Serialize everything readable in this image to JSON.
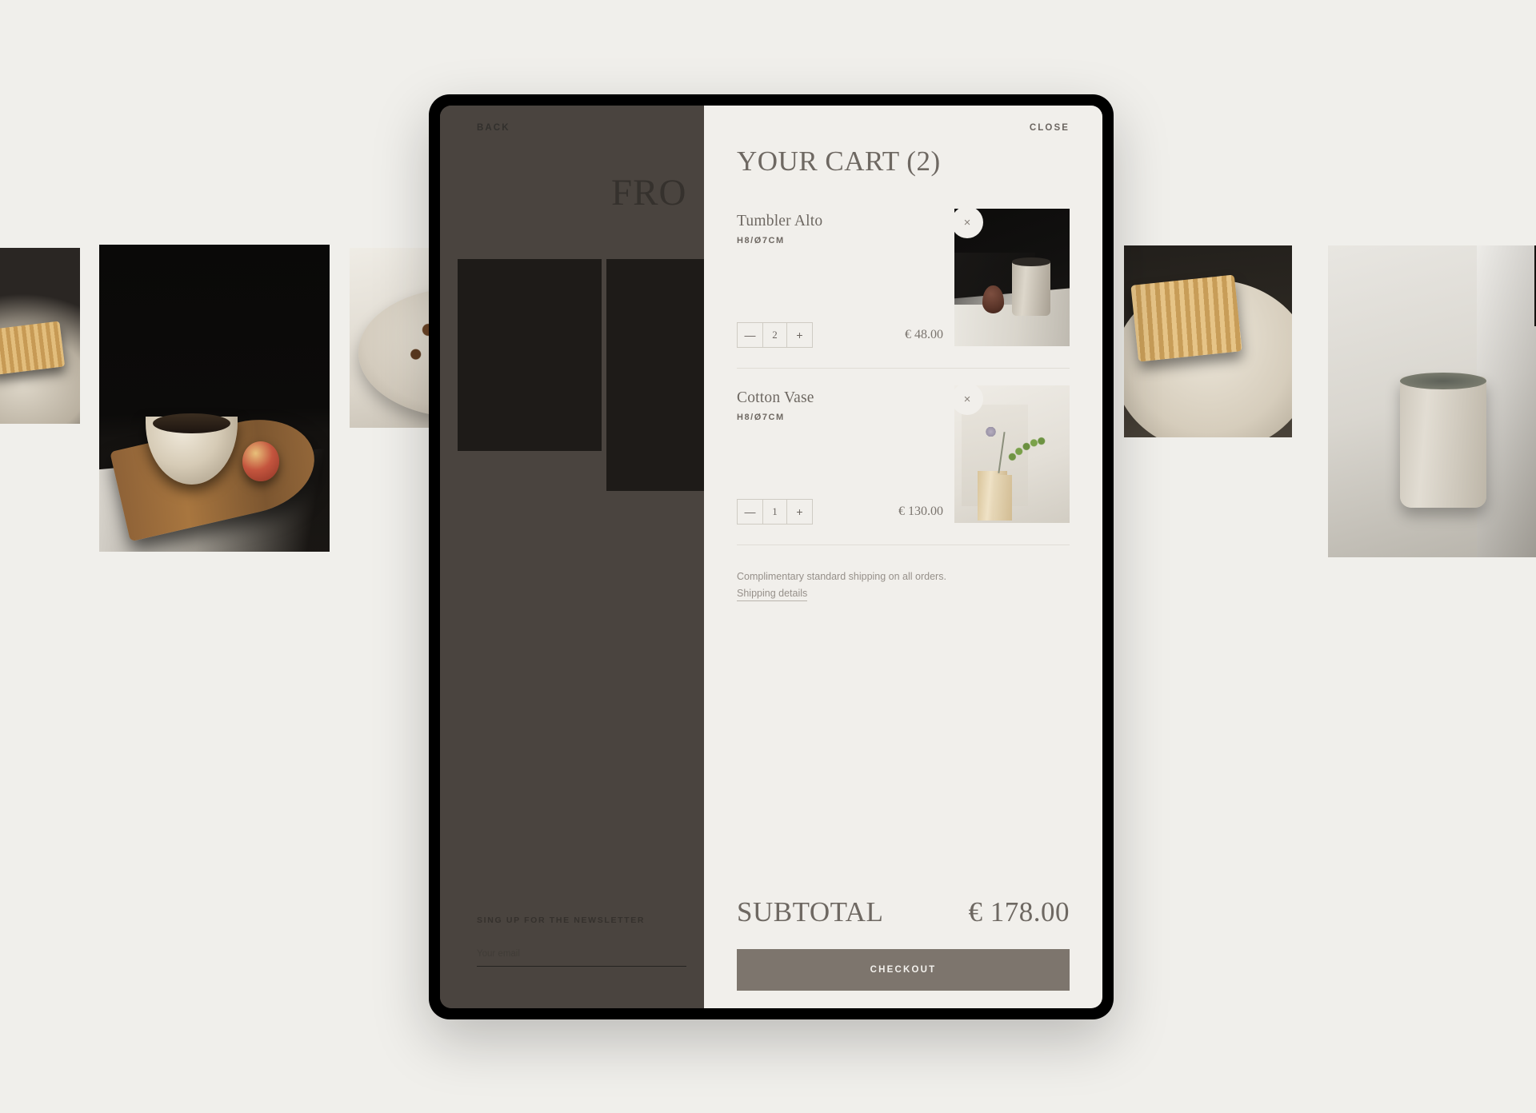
{
  "page": {
    "background_color": "#f0efeb"
  },
  "site": {
    "back_label": "BACK",
    "hero_heading": "FRO",
    "newsletter": {
      "label": "SING UP FOR THE NEWSLETTER",
      "email_placeholder": "Your email",
      "email_value": ""
    }
  },
  "cart": {
    "close_label": "CLOSE",
    "title": "YOUR CART (2)",
    "items": [
      {
        "name": "Tumbler Alto",
        "size": "H8/Ø7CM",
        "quantity": "2",
        "price": "€ 48.00",
        "decrease_label": "—",
        "increase_label": "+",
        "remove_label": "×"
      },
      {
        "name": "Cotton Vase",
        "size": "H8/Ø7CM",
        "quantity": "1",
        "price": "€ 130.00",
        "decrease_label": "—",
        "increase_label": "+",
        "remove_label": "×"
      }
    ],
    "shipping_note": "Complimentary standard shipping on all orders.",
    "shipping_link": "Shipping details",
    "subtotal_label": "SUBTOTAL",
    "subtotal_value": "€ 178.00",
    "checkout_label": "CHECKOUT",
    "accent_color": "#7d756d",
    "panel_color": "#f1efeb",
    "text_color": "#6e6862"
  }
}
